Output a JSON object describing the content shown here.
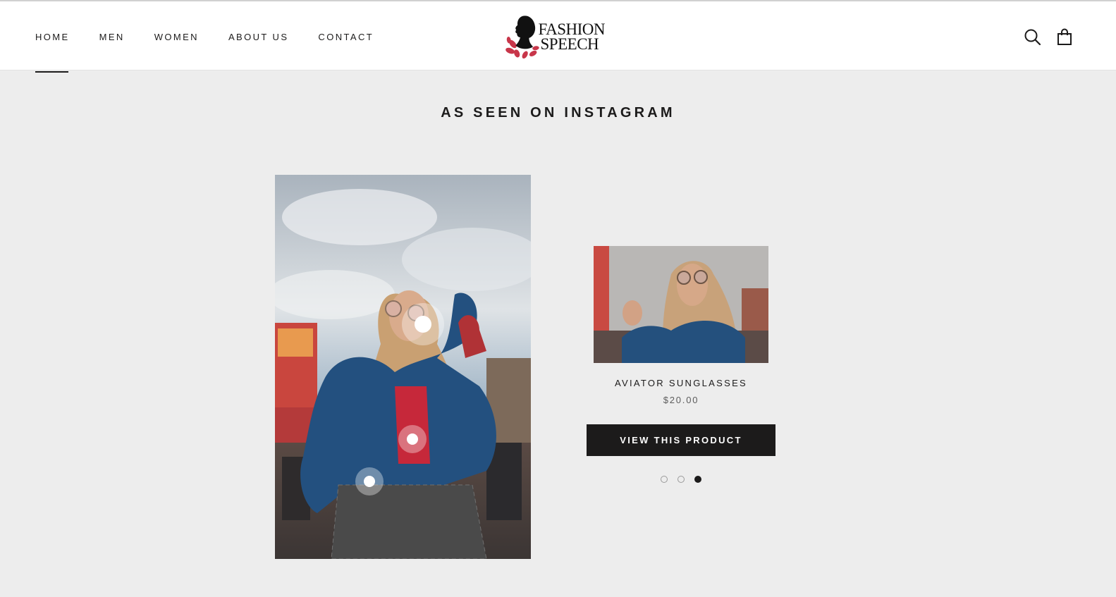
{
  "nav": {
    "items": [
      {
        "label": "HOME",
        "active": true
      },
      {
        "label": "MEN",
        "active": false
      },
      {
        "label": "WOMEN",
        "active": false
      },
      {
        "label": "ABOUT US",
        "active": false
      },
      {
        "label": "CONTACT",
        "active": false
      }
    ]
  },
  "brand": {
    "line1": "FASHION",
    "line2": "SPEECH"
  },
  "header_icons": [
    "search-icon",
    "shopping-bag-icon"
  ],
  "section": {
    "title": "AS SEEN ON INSTAGRAM"
  },
  "product": {
    "name": "AVIATOR SUNGLASSES",
    "price": "$20.00",
    "button_label": "VIEW THIS PRODUCT"
  },
  "carousel": {
    "total": 3,
    "active_index": 2
  },
  "colors": {
    "accent": "#1c1b1b",
    "background": "#ededed",
    "logo_red": "#c8364a"
  }
}
